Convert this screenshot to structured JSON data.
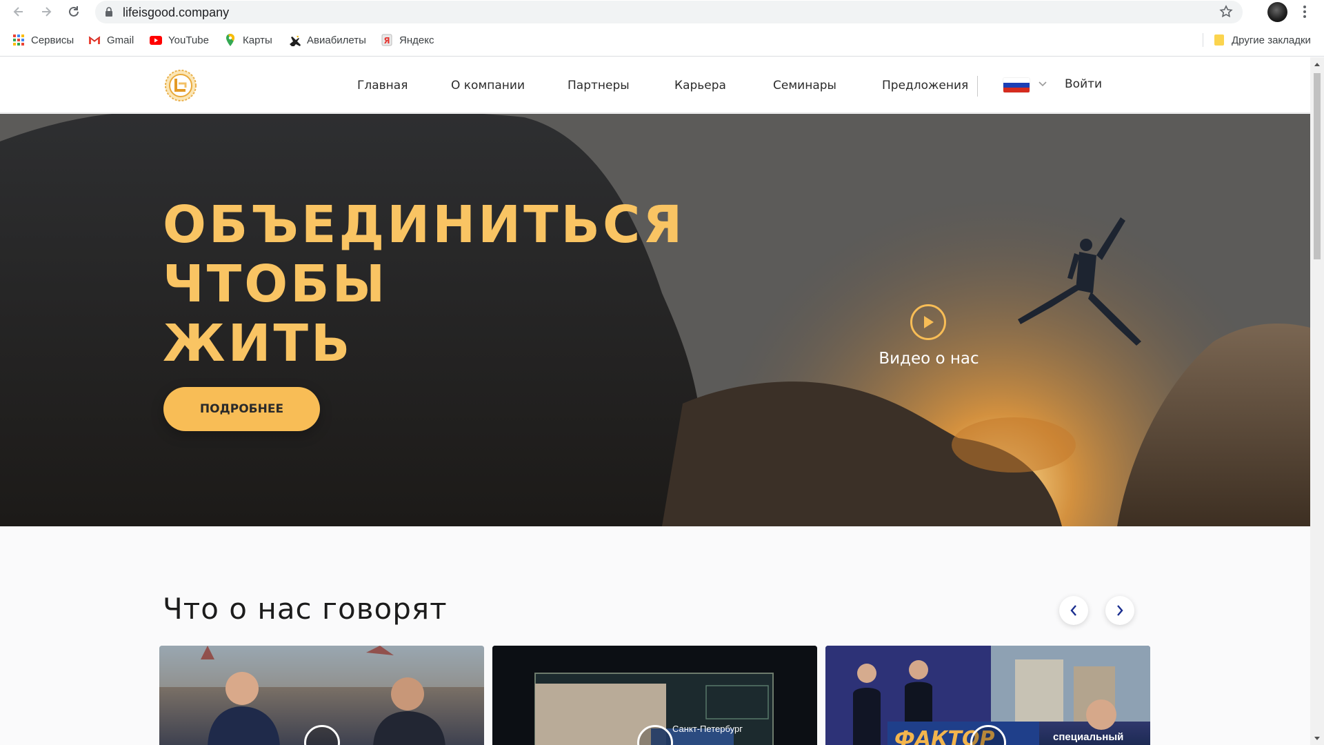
{
  "browser": {
    "url": "lifeisgood.company",
    "bookmarks": [
      {
        "label": "Сервисы",
        "icon": "apps-grid-icon"
      },
      {
        "label": "Gmail",
        "icon": "gmail-icon"
      },
      {
        "label": "YouTube",
        "icon": "youtube-icon"
      },
      {
        "label": "Карты",
        "icon": "maps-pin-icon"
      },
      {
        "label": "Авиабилеты",
        "icon": "plane-icon"
      },
      {
        "label": "Яндекс",
        "icon": "yandex-icon"
      }
    ],
    "other_bookmarks": "Другие закладки"
  },
  "site": {
    "nav": {
      "items": [
        "Главная",
        "О компании",
        "Партнеры",
        "Карьера",
        "Семинары",
        "Предложения"
      ],
      "login": "Войти",
      "language_flag": "russia-flag-icon"
    },
    "hero": {
      "title_lines": [
        "ОБЪЕДИНИТЬСЯ",
        "ЧТОБЫ",
        "ЖИТЬ"
      ],
      "button": "ПОДРОБНЕЕ",
      "video_label": "Видео о нас"
    },
    "testimonials": {
      "title": "Что о нас говорят",
      "cards": [
        {
          "overlay": ""
        },
        {
          "overlay": "Санкт-Петербург"
        },
        {
          "overlay": "специальный"
        }
      ]
    }
  },
  "colors": {
    "accent": "#f8bd56",
    "hero_title": "#f9c463",
    "nav_blue": "#1a2e8f"
  }
}
